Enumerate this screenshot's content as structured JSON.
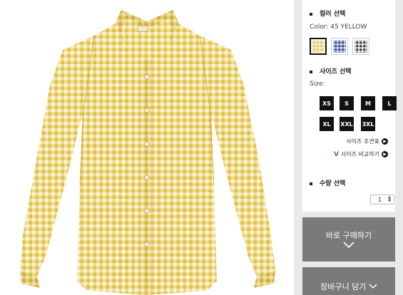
{
  "product_image": {
    "brand_tag": "UNIQLO",
    "colors": {
      "shirt": "#e3c44e",
      "check_line": "#f4e8b0",
      "button": "#f6f0d8"
    }
  },
  "color_section": {
    "title": "컬러 선택",
    "current_label": "Color: 45 YELLOW",
    "swatches": [
      {
        "name": "yellow",
        "selected": true
      },
      {
        "name": "navy",
        "selected": false
      },
      {
        "name": "black",
        "selected": false
      }
    ]
  },
  "size_section": {
    "title": "사이즈 선택",
    "label": "Size:",
    "sizes": [
      "XS",
      "S",
      "M",
      "L",
      "XL",
      "XXL",
      "3XL"
    ],
    "size_chart_link": "사이즈 조견표",
    "compare_link": "사이즈 비교하기"
  },
  "quantity_section": {
    "title": "수량 선택",
    "value": "1"
  },
  "actions": {
    "buy_now": "바로 구매하기",
    "add_to_cart": "장바구니 담기"
  },
  "icons": {
    "arrow": "chevron-right-icon",
    "down": "chevron-down-icon"
  }
}
